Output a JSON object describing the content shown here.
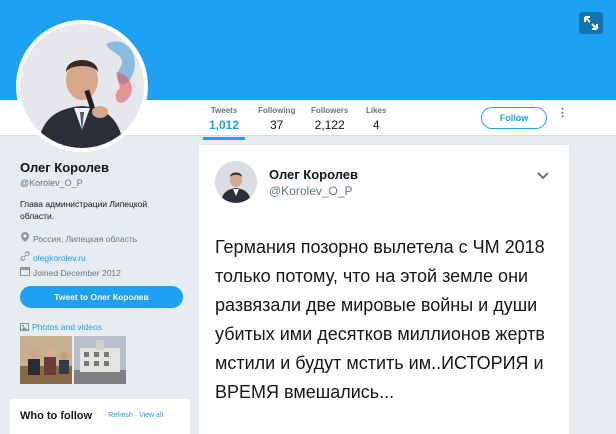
{
  "colors": {
    "accent": "#1da1f2",
    "banner": "#1da1f2",
    "background": "#e6ecf0",
    "muted": "#657786",
    "text": "#14171a"
  },
  "expand": {
    "icon": "expand-arrows-icon"
  },
  "nav": {
    "stats": [
      {
        "label": "Tweets",
        "value": "1,012"
      },
      {
        "label": "Following",
        "value": "37"
      },
      {
        "label": "Followers",
        "value": "2,122"
      },
      {
        "label": "Likes",
        "value": "4"
      }
    ],
    "follow_label": "Follow",
    "more_icon": "more-vertical-icon"
  },
  "profile": {
    "name": "Олег Королев",
    "handle": "@Korolev_O_P",
    "bio": "Глава администрации Липецкой области.",
    "location": "Россия, Липецкая область",
    "website": "olegkorolev.ru",
    "joined": "Joined December 2012",
    "tweet_to_label": "Tweet to Олег Королев",
    "photos_label": "Photos and videos"
  },
  "who_to_follow": {
    "title": "Who to follow",
    "refresh": "Refresh",
    "view_all": "View all",
    "separator": "·"
  },
  "tweet": {
    "name": "Олег Королев",
    "handle": "@Korolev_O_P",
    "text": "Германия позорно вылетела с ЧМ 2018 только потому, что на этой земле они развязали две мировые войны и души убитых ими десятков миллионов жертв мстили и будут мстить им..ИСТОРИЯ и ВРЕМЯ вмешались..."
  }
}
